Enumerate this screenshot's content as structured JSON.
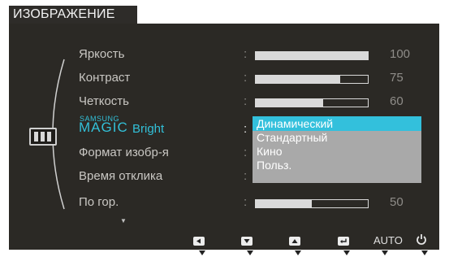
{
  "header": {
    "title": "ИЗОБРАЖЕНИЕ"
  },
  "menu": {
    "items": [
      {
        "label": "Яркость",
        "value": "100",
        "level": 100
      },
      {
        "label": "Контраст",
        "value": "75",
        "level": 75
      },
      {
        "label": "Четкость",
        "value": "60",
        "level": 60
      },
      {
        "label": "Формат изобр-я"
      },
      {
        "label": "Время отклика"
      },
      {
        "label": "По гор.",
        "value": "50",
        "level": 50
      }
    ],
    "active_item": {
      "brand": "SAMSUNG",
      "magic": "MAGIC",
      "label": "Bright"
    },
    "colon": ":"
  },
  "dropdown": {
    "options": [
      "Динамический",
      "Стандартный",
      "Кино",
      "Польз."
    ],
    "selected": "Динамический"
  },
  "footer": {
    "buttons": [
      "left-arrow-icon",
      "down-arrow-icon",
      "up-arrow-icon",
      "enter-icon"
    ],
    "auto_label": "AUTO",
    "power_icon": "power-icon"
  },
  "colors": {
    "accent": "#33c0dc",
    "panel": "#2b2925",
    "dropdown": "#a9a9a9"
  }
}
